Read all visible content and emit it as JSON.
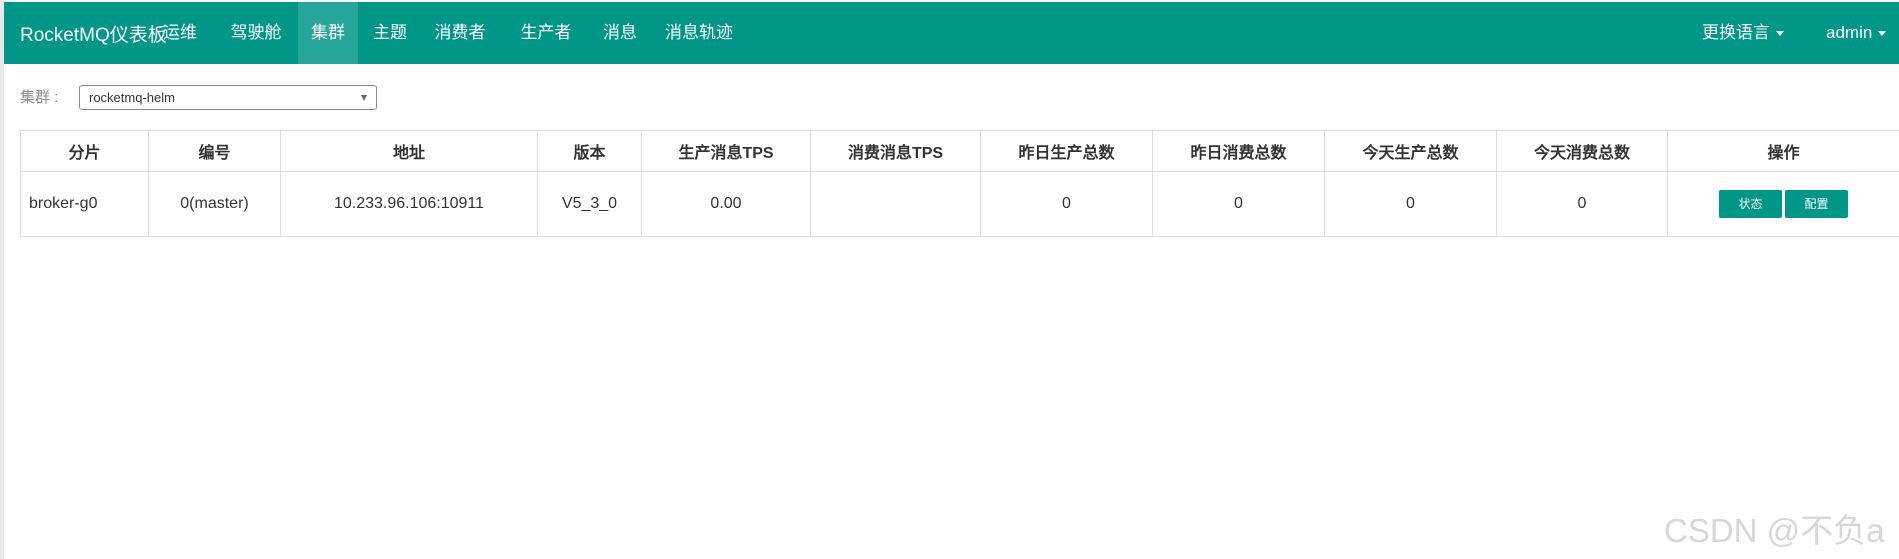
{
  "header": {
    "brand": "RocketMQ仪表板",
    "nav": [
      {
        "label": "运维"
      },
      {
        "label": "驾驶舱"
      },
      {
        "label": "集群"
      },
      {
        "label": "主题"
      },
      {
        "label": "消费者"
      },
      {
        "label": "生产者"
      },
      {
        "label": "消息"
      },
      {
        "label": "消息轨迹"
      }
    ],
    "active_nav": "集群",
    "language_label": "更换语言",
    "user_label": "admin"
  },
  "filter": {
    "label": "集群 :",
    "cluster_value": "rocketmq-helm"
  },
  "table": {
    "columns": [
      "分片",
      "编号",
      "地址",
      "版本",
      "生产消息TPS",
      "消费消息TPS",
      "昨日生产总数",
      "昨日消费总数",
      "今天生产总数",
      "今天消费总数",
      "操作"
    ],
    "rows": [
      {
        "shard": "broker-g0",
        "id": "0(master)",
        "address": "10.233.96.106:10911",
        "version": "V5_3_0",
        "produce_tps": "0.00",
        "consume_tps": "",
        "yesterday_produce": "0",
        "yesterday_consume": "0",
        "today_produce": "0",
        "today_consume": "0",
        "actions": {
          "status": "状态",
          "config": "配置"
        }
      }
    ]
  },
  "watermark": "CSDN @不负a",
  "colors": {
    "primary": "#009688",
    "active_nav": "#26a69a"
  }
}
